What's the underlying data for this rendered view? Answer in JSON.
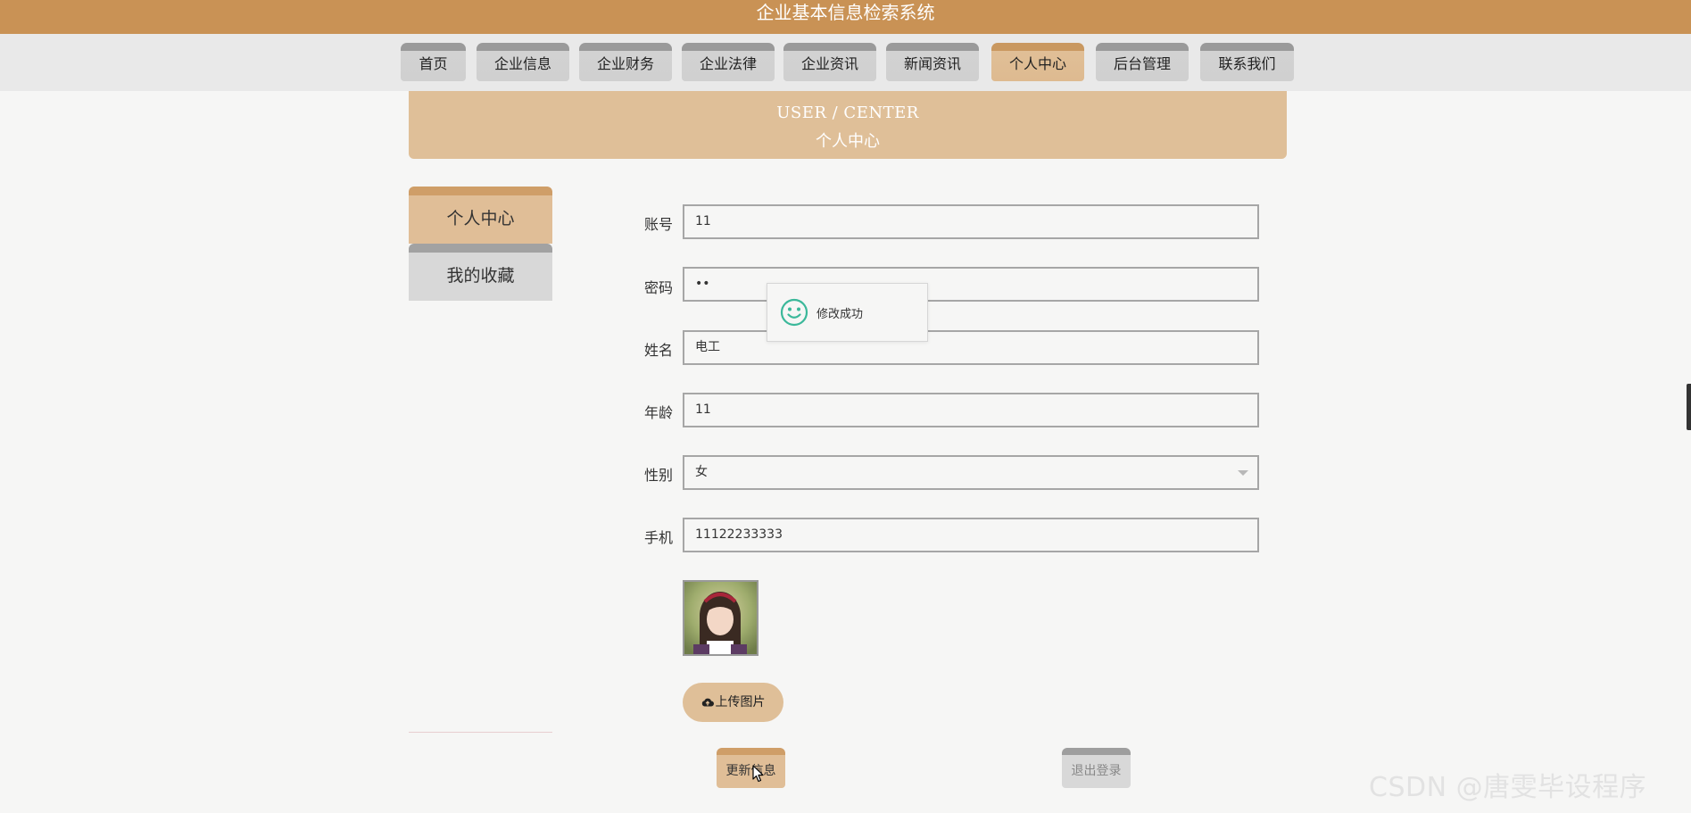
{
  "app": {
    "title": "企业基本信息检索系统"
  },
  "nav": {
    "items": [
      {
        "label": "首页"
      },
      {
        "label": "企业信息"
      },
      {
        "label": "企业财务"
      },
      {
        "label": "企业法律"
      },
      {
        "label": "企业资讯"
      },
      {
        "label": "新闻资讯"
      },
      {
        "label": "个人中心"
      },
      {
        "label": "后台管理"
      },
      {
        "label": "联系我们"
      }
    ],
    "active": "个人中心"
  },
  "banner": {
    "en": "USER / CENTER",
    "zh": "个人中心"
  },
  "side_menu": {
    "items": [
      {
        "label": "个人中心"
      },
      {
        "label": "我的收藏"
      }
    ],
    "active": "个人中心"
  },
  "form": {
    "account": {
      "label": "账号",
      "value": "11"
    },
    "password": {
      "label": "密码",
      "value": "••"
    },
    "name": {
      "label": "姓名",
      "value": "电工"
    },
    "age": {
      "label": "年龄",
      "value": "11"
    },
    "gender": {
      "label": "性别",
      "value": "女"
    },
    "phone": {
      "label": "手机",
      "value": "11122233333"
    }
  },
  "buttons": {
    "upload": "上传图片",
    "update": "更新信息",
    "logout": "退出登录"
  },
  "toast": {
    "message": "修改成功"
  },
  "watermark": "CSDN @唐雯毕设程序",
  "colors": {
    "brand": "#c99255",
    "accent": "#dfbf98",
    "tab_inactive": "#d0d0d0",
    "success_icon": "#3bb89a"
  },
  "icons": {
    "toast": "smile-icon",
    "upload": "cloud-upload-icon"
  }
}
